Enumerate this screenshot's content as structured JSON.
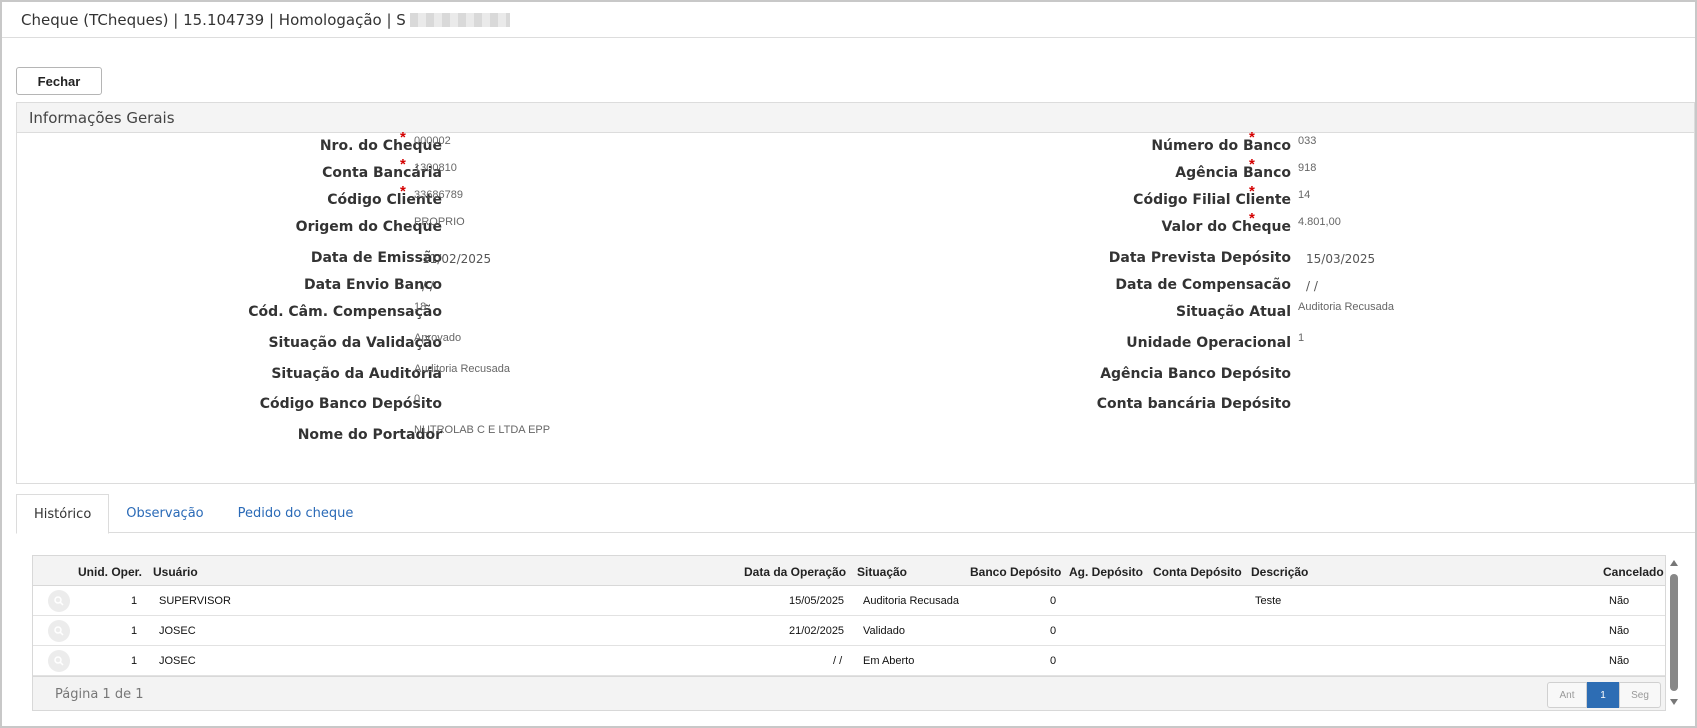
{
  "window": {
    "title": "Cheque (TCheques) | 15.104739 | Homologação | S"
  },
  "toolbar": {
    "close_label": "Fechar"
  },
  "panel": {
    "title": "Informações Gerais",
    "left_fields": [
      {
        "label": "Nro. do Cheque",
        "value": "000002",
        "required": true
      },
      {
        "label": "Conta Bancária",
        "value": "1300810",
        "required": true
      },
      {
        "label": "Código Cliente",
        "value": "33686789",
        "required": true
      },
      {
        "label": "Origem do Cheque",
        "value": "PROPRIO",
        "required": false
      },
      {
        "label": "Data de Emissão",
        "value": "11/02/2025",
        "required": false
      },
      {
        "label": "Data Envio Banco",
        "value": " / /",
        "required": false
      },
      {
        "label": "Cód. Câm. Compensação",
        "value": "18",
        "required": false
      },
      {
        "label": "Situação da Validação",
        "value": "Aprovado",
        "required": false
      },
      {
        "label": "Situação da Auditoria",
        "value": "Auditoria Recusada",
        "required": false
      },
      {
        "label": "Código Banco Depósito",
        "value": "0",
        "required": false
      },
      {
        "label": "Nome do Portador",
        "value": "NUTROLAB C E LTDA EPP",
        "required": false
      }
    ],
    "right_fields": [
      {
        "label": "Número do Banco",
        "value": "033",
        "required": true
      },
      {
        "label": "Agência Banco",
        "value": "918",
        "required": true
      },
      {
        "label": "Código Filial Cliente",
        "value": "14",
        "required": true
      },
      {
        "label": "Valor do Cheque",
        "value": "4.801,00",
        "required": true
      },
      {
        "label": "Data Prevista Depósito",
        "value": "15/03/2025",
        "required": false
      },
      {
        "label": "Data de Compensacão",
        "value": " / /",
        "required": false
      },
      {
        "label": "Situação Atual",
        "value": "Auditoria Recusada",
        "required": false
      },
      {
        "label": "Unidade Operacional",
        "value": "1",
        "required": false
      },
      {
        "label": "Agência Banco Depósito",
        "value": "",
        "required": false
      },
      {
        "label": "Conta bancária Depósito",
        "value": "",
        "required": false
      }
    ]
  },
  "tabs": [
    {
      "label": "Histórico",
      "active": true
    },
    {
      "label": "Observação",
      "active": false
    },
    {
      "label": "Pedido do cheque",
      "active": false
    }
  ],
  "grid": {
    "columns": [
      "Unid. Oper.",
      "Usuário",
      "Data da Operação",
      "Situação",
      "Banco Depósito",
      "Ag. Depósito",
      "Conta Depósito",
      "Descrição",
      "Cancelado"
    ],
    "rows": [
      {
        "unid": "1",
        "usuario": "SUPERVISOR",
        "data": "15/05/2025",
        "situacao": "Auditoria Recusada",
        "banco": "0",
        "agencia": "",
        "conta": "",
        "descricao": "Teste",
        "cancelado": "Não"
      },
      {
        "unid": "1",
        "usuario": "JOSEC",
        "data": "21/02/2025",
        "situacao": "Validado",
        "banco": "0",
        "agencia": "",
        "conta": "",
        "descricao": "",
        "cancelado": "Não"
      },
      {
        "unid": "1",
        "usuario": "JOSEC",
        "data": "/ /",
        "situacao": "Em Aberto",
        "banco": "0",
        "agencia": "",
        "conta": "",
        "descricao": "",
        "cancelado": "Não"
      }
    ],
    "page_info": "Página 1 de 1",
    "pager": {
      "prev": "Ant",
      "current": "1",
      "next": "Seg"
    }
  },
  "icons": {
    "row_action": "search-icon"
  },
  "colors": {
    "required": "#d40000",
    "link": "#2a6ab7",
    "pager_active": "#2d6db4"
  }
}
